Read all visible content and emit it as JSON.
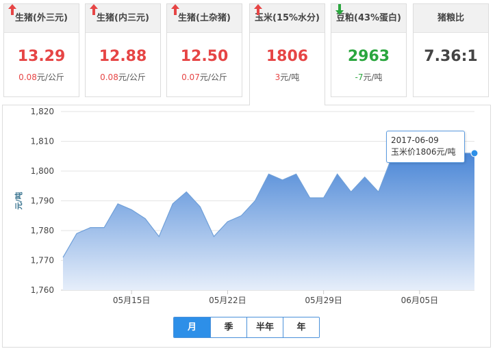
{
  "cards": [
    {
      "title": "生猪(外三元)",
      "price": "13.29",
      "change": "0.08",
      "unit": "元/公斤",
      "dir": "up"
    },
    {
      "title": "生猪(内三元)",
      "price": "12.88",
      "change": "0.08",
      "unit": "元/公斤",
      "dir": "up"
    },
    {
      "title": "生猪(土杂猪)",
      "price": "12.50",
      "change": "0.07",
      "unit": "元/公斤",
      "dir": "up"
    },
    {
      "title": "玉米(15%水分)",
      "price": "1806",
      "change": "3",
      "unit": "元/吨",
      "dir": "up",
      "active": true
    },
    {
      "title": "豆粕(43%蛋白)",
      "price": "2963",
      "change": "-7",
      "unit": "元/吨",
      "dir": "down"
    },
    {
      "title": "猪粮比",
      "price": "7.36:1",
      "change": "",
      "unit": "",
      "dir": "none"
    }
  ],
  "tooltip": {
    "date": "2017-06-09",
    "text": "玉米价1806元/吨"
  },
  "range_buttons": [
    "月",
    "季",
    "半年",
    "年"
  ],
  "active_range": "月",
  "colors": {
    "up": "#e64545",
    "down": "#2aa63e",
    "line": "#6f9fd8",
    "accent": "#2d8fe8"
  },
  "chart_data": {
    "type": "area",
    "ylabel": "元/吨",
    "ylim": [
      1760,
      1820
    ],
    "yticks": [
      1760,
      1770,
      1780,
      1790,
      1800,
      1810,
      1820
    ],
    "ytick_labels": [
      "1,760",
      "1,770",
      "1,780",
      "1,790",
      "1,800",
      "1,810",
      "1,820"
    ],
    "x_start": "2017-05-10",
    "x_labels": [
      {
        "date": "2017-05-15",
        "label": "05月15日"
      },
      {
        "date": "2017-05-22",
        "label": "05月22日"
      },
      {
        "date": "2017-05-29",
        "label": "05月29日"
      },
      {
        "date": "2017-06-05",
        "label": "06月05日"
      }
    ],
    "dates": [
      "2017-05-10",
      "2017-05-11",
      "2017-05-12",
      "2017-05-13",
      "2017-05-14",
      "2017-05-15",
      "2017-05-16",
      "2017-05-17",
      "2017-05-18",
      "2017-05-19",
      "2017-05-20",
      "2017-05-21",
      "2017-05-22",
      "2017-05-23",
      "2017-05-24",
      "2017-05-25",
      "2017-05-26",
      "2017-05-27",
      "2017-05-28",
      "2017-05-29",
      "2017-05-30",
      "2017-05-31",
      "2017-06-01",
      "2017-06-02",
      "2017-06-03",
      "2017-06-04",
      "2017-06-05",
      "2017-06-06",
      "2017-06-07",
      "2017-06-08",
      "2017-06-09"
    ],
    "values": [
      1771,
      1779,
      1781,
      1781,
      1789,
      1787,
      1784,
      1778,
      1789,
      1793,
      1788,
      1778,
      1783,
      1785,
      1790,
      1799,
      1797,
      1799,
      1791,
      1791,
      1799,
      1793,
      1798,
      1793,
      1805,
      1806,
      1806,
      1806,
      1806,
      1806,
      1806
    ],
    "highlight_index": 30,
    "grid": true
  }
}
